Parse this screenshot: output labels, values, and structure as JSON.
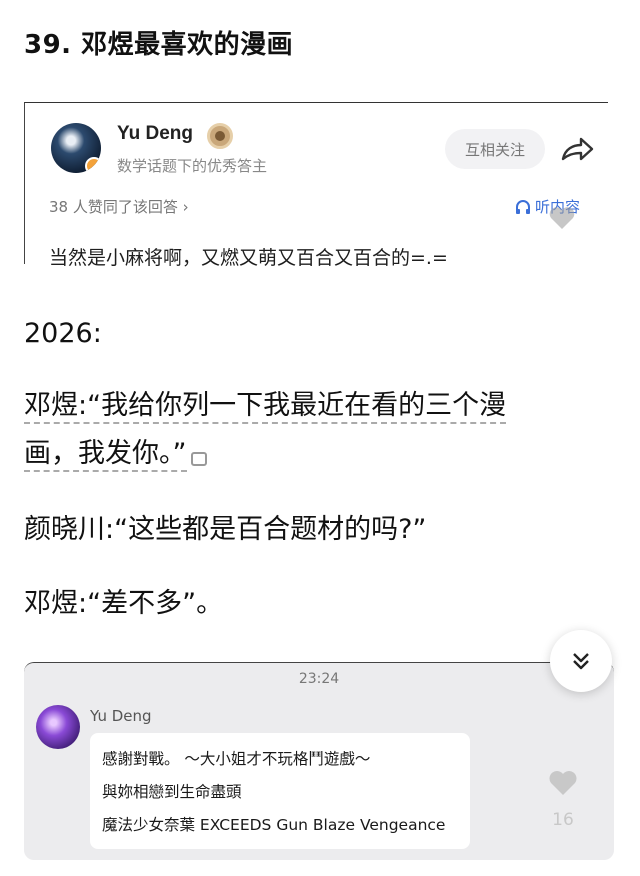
{
  "heading": "39. 邓煜最喜欢的漫画",
  "embed": {
    "name": "Yu Deng",
    "subtitle": "数学话题下的优秀答主",
    "follow_label": "互相关注",
    "likes_text": "38 人赞同了该回答 ›",
    "listen_label": "听内容",
    "answer": "当然是小麻将啊，又燃又萌又百合又百合的=.="
  },
  "story": {
    "year": "2026:",
    "line1": "邓煜:“我给你列一下我最近在看的三个漫",
    "line2": "画，我发你。”",
    "line3": "颜晓川:“这些都是百合题材的吗?”",
    "line4": "邓煜:“差不多”。"
  },
  "chat": {
    "time": "23:24",
    "name": "Yu Deng",
    "messages": [
      "感謝對戰。 ～大小姐才不玩格鬥遊戲～",
      "與妳相戀到生命盡頭",
      "魔法少女奈葉 EXCEEDS Gun Blaze Vengeance"
    ]
  },
  "like_count": "16",
  "colors": {
    "accent": "#3b6fd8",
    "badge": "#f3a23a"
  }
}
